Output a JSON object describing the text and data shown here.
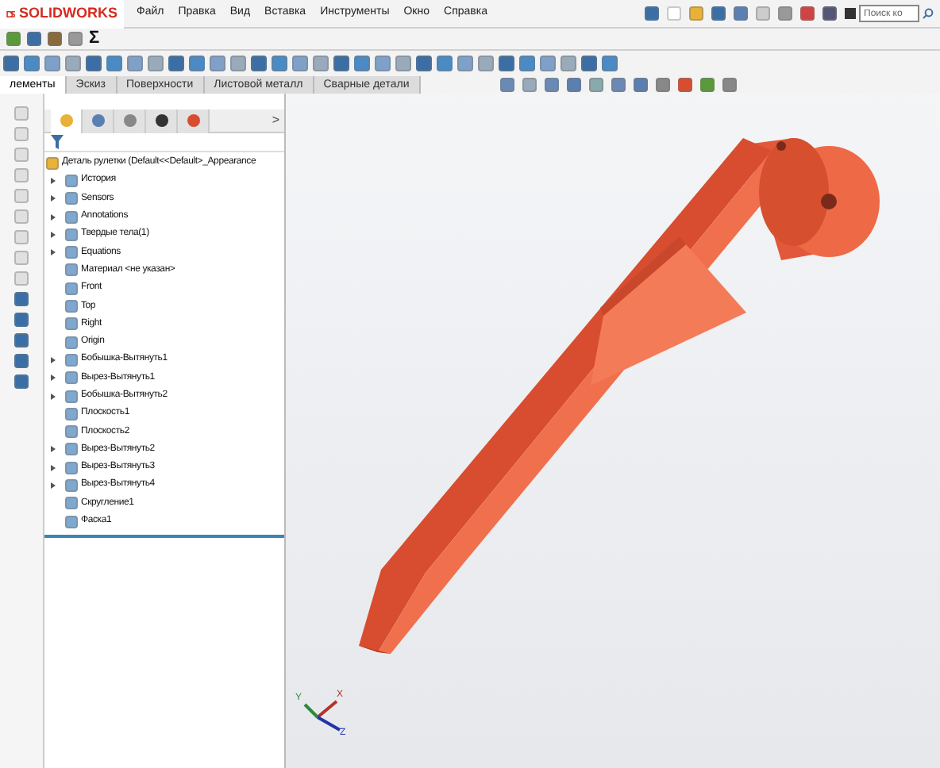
{
  "app": {
    "logo": "SOLIDWORKS"
  },
  "menu": [
    "Файл",
    "Правка",
    "Вид",
    "Вставка",
    "Инструменты",
    "Окно",
    "Справка"
  ],
  "search": {
    "placeholder": "Поиск ко"
  },
  "quick_toolbar": {
    "sum_symbol": "Σ"
  },
  "command_tabs": [
    {
      "label": "лементы",
      "selected": true
    },
    {
      "label": "Эскиз",
      "selected": false
    },
    {
      "label": "Поверхности",
      "selected": false
    },
    {
      "label": "Листовой металл",
      "selected": false
    },
    {
      "label": "Сварные детали",
      "selected": false
    }
  ],
  "panel_tabs": [
    {
      "selected": true
    },
    {
      "selected": false
    },
    {
      "selected": false
    },
    {
      "selected": false
    },
    {
      "selected": false
    }
  ],
  "panel_more": ">",
  "tree": {
    "label": "Деталь рулетки  (Default<<Default>_Appearance",
    "children": [
      {
        "label": "История",
        "expandable": true
      },
      {
        "label": "Sensors",
        "expandable": true
      },
      {
        "label": "Annotations",
        "expandable": true
      },
      {
        "label": "Твердые тела(1)",
        "expandable": true
      },
      {
        "label": "Equations",
        "expandable": true
      },
      {
        "label": "Материал <не указан>",
        "expandable": false
      },
      {
        "label": "Front",
        "expandable": false
      },
      {
        "label": "Top",
        "expandable": false
      },
      {
        "label": "Right",
        "expandable": false
      },
      {
        "label": "Origin",
        "expandable": false
      },
      {
        "label": "Бобышка-Вытянуть1",
        "expandable": true
      },
      {
        "label": "Вырез-Вытянуть1",
        "expandable": true
      },
      {
        "label": "Бобышка-Вытянуть2",
        "expandable": true
      },
      {
        "label": "Плоскость1",
        "expandable": false
      },
      {
        "label": "Плоскость2",
        "expandable": false
      },
      {
        "label": "Вырез-Вытянуть2",
        "expandable": true
      },
      {
        "label": "Вырез-Вытянуть3",
        "expandable": true
      },
      {
        "label": "Вырез-Вытянуть4",
        "expandable": true
      },
      {
        "label": "Скругление1",
        "expandable": false
      },
      {
        "label": "Фаска1",
        "expandable": false
      }
    ]
  },
  "triad": {
    "y": "Y",
    "x": "X",
    "z": "Z"
  }
}
